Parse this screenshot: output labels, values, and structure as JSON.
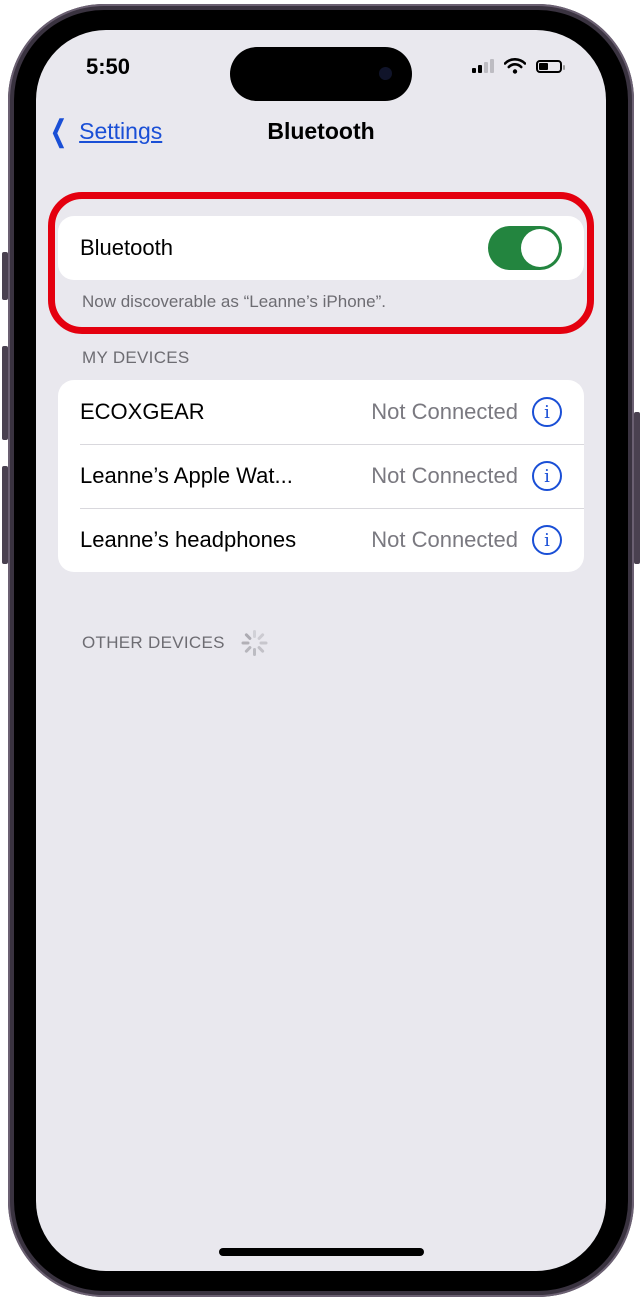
{
  "status_bar": {
    "time": "5:50",
    "signal_bars_active": 2,
    "signal_bars_total": 4,
    "wifi_icon": "wifi-icon",
    "battery_level": 0.5
  },
  "nav": {
    "back_label": "Settings",
    "back_icon": "chevron-left-icon",
    "title": "Bluetooth"
  },
  "bluetooth": {
    "label": "Bluetooth",
    "enabled": true,
    "toggle_color": "#23853f",
    "discoverable_note": "Now discoverable as “Leanne’s iPhone”."
  },
  "my_devices": {
    "header": "MY DEVICES",
    "items": [
      {
        "name": "ECOXGEAR",
        "status": "Not Connected"
      },
      {
        "name": "Leanne’s Apple Wat...",
        "status": "Not Connected"
      },
      {
        "name": "Leanne’s headphones",
        "status": "Not Connected"
      }
    ]
  },
  "other_devices": {
    "header": "OTHER DEVICES",
    "loading": true
  },
  "colors": {
    "accent": "#1a4fd6",
    "highlight_ring": "#e4000f",
    "background": "#e9e8ee"
  }
}
